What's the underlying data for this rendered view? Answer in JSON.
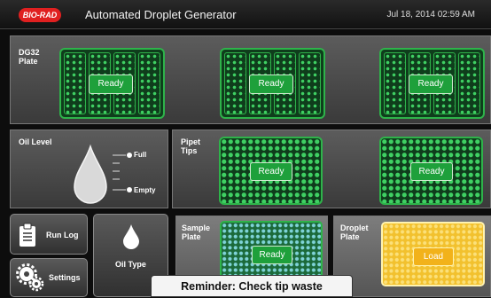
{
  "header": {
    "logo": "BIO-RAD",
    "title": "Automated Droplet Generator",
    "datetime": "Jul 18, 2014 02:59 AM"
  },
  "dg32": {
    "label_line1": "DG32",
    "label_line2": "Plate",
    "plates": [
      {
        "status": "Ready"
      },
      {
        "status": "Ready"
      },
      {
        "status": "Ready"
      }
    ]
  },
  "oil_level": {
    "label": "Oil Level",
    "full_label": "Full",
    "empty_label": "Empty"
  },
  "pipet_tips": {
    "label_line1": "Pipet",
    "label_line2": "Tips",
    "racks": [
      {
        "status": "Ready"
      },
      {
        "status": "Ready"
      }
    ]
  },
  "buttons": {
    "run_log": "Run Log",
    "settings": "Settings",
    "oil_type": "Oil Type"
  },
  "sample_plate": {
    "label_line1": "Sample",
    "label_line2": "Plate",
    "status": "Ready"
  },
  "droplet_plate": {
    "label_line1": "Droplet",
    "label_line2": "Plate",
    "status": "Load"
  },
  "reminder": "Reminder: Check tip waste",
  "colors": {
    "ready_green": "#1ea03b",
    "load_yellow": "#f2c12e",
    "logo_red": "#e02020"
  },
  "icons": [
    "clipboard-icon",
    "gears-icon",
    "oil-drop-icon"
  ]
}
